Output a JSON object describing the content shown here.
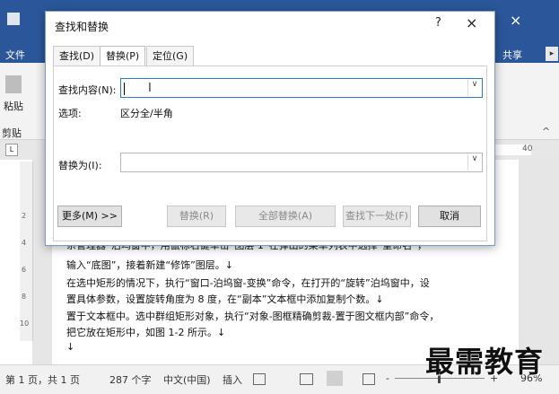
{
  "word": {
    "tab_file_partial": "文件",
    "share_partial": "共享",
    "ribbon_paste_partial": "粘贴",
    "ribbon_clipboard_partial": "剪贴",
    "ruler_number": "40",
    "vruler_marks": [
      "2",
      "4",
      "6",
      "8",
      "10"
    ]
  },
  "document": {
    "lines": [
      "系管理器”泊坞窗中，用鼠标右键单击“图层 1”在弹出的菜单列表中选择“重命名”，",
      "输入“底图”，接着新建“修饰”图层。↓",
      "在选中矩形的情况下，执行“窗口-泊坞窗-变换”命令，在打开的“旋转”泊坞窗中，设",
      "置具体参数，设置旋转角度为 8 度，在“副本”文本框中添加复制个数。↓",
      "置于文本框中。选中群组矩形对象，执行“对象-图框精确剪裁-置于图文框内部”命令，",
      "把它放在矩形中，如图 1-2 所示。↓",
      "↓"
    ]
  },
  "status_bar": {
    "page_info": "第 1 页，共 1 页",
    "word_count": "287 个字",
    "language": "中文(中国)",
    "insert_mode": "插入",
    "zoom_minus": "-",
    "zoom_plus": "+",
    "zoom_level": "96%"
  },
  "watermark": "最需教育",
  "dialog": {
    "title": "查找和替换",
    "help": "?",
    "close": "×",
    "tabs": [
      {
        "label": "查找(D)",
        "active": false
      },
      {
        "label": "替换(P)",
        "active": true
      },
      {
        "label": "定位(G)",
        "active": false
      }
    ],
    "find_label": "查找内容(N):",
    "find_value": "",
    "options_label": "选项:",
    "options_value": "区分全/半角",
    "replace_label": "替换为(I):",
    "replace_value": "",
    "buttons": {
      "more": "更多(M) >>",
      "replace": "替换(R)",
      "replace_all": "全部替换(A)",
      "find_next": "查找下一处(F)",
      "cancel": "取消"
    }
  }
}
